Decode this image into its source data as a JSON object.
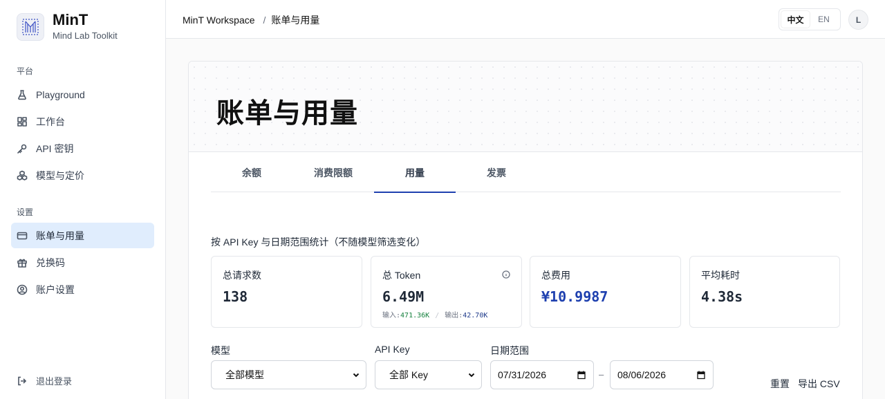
{
  "brand": {
    "name": "MinT",
    "subtitle": "Mind Lab Toolkit"
  },
  "sidebar": {
    "platform_label": "平台",
    "platform_items": [
      {
        "label": "Playground",
        "icon": "flask-icon"
      },
      {
        "label": "工作台",
        "icon": "dashboard-icon"
      },
      {
        "label": "API 密钥",
        "icon": "key-icon"
      },
      {
        "label": "模型与定价",
        "icon": "cubes-icon"
      }
    ],
    "settings_label": "设置",
    "settings_items": [
      {
        "label": "账单与用量",
        "icon": "credit-card-icon",
        "active": true
      },
      {
        "label": "兑换码",
        "icon": "gift-icon"
      },
      {
        "label": "账户设置",
        "icon": "user-circle-icon"
      }
    ],
    "logout_label": "退出登录"
  },
  "header": {
    "workspace": "MinT Workspace",
    "separator": "/",
    "current": "账单与用量",
    "lang_zh": "中文",
    "lang_en": "EN",
    "avatar_initial": "L"
  },
  "page": {
    "title": "账单与用量",
    "tabs": [
      {
        "label": "余额"
      },
      {
        "label": "消费限额"
      },
      {
        "label": "用量",
        "active": true
      },
      {
        "label": "发票"
      }
    ],
    "stat_note": "按 API Key 与日期范围统计（不随模型筛选变化）",
    "stats": {
      "requests": {
        "label": "总请求数",
        "value": "138"
      },
      "tokens": {
        "label": "总 Token",
        "value": "6.49M",
        "input_label": "输入:",
        "input_value": "471.36K",
        "sep": "/",
        "output_label": "输出:",
        "output_value": "42.70K"
      },
      "cost": {
        "label": "总费用",
        "value": "¥10.9987"
      },
      "latency": {
        "label": "平均耗时",
        "value": "4.38s"
      }
    },
    "filters": {
      "model_label": "模型",
      "model_value": "全部模型",
      "key_label": "API Key",
      "key_value": "全部 Key",
      "date_label": "日期范围",
      "date_from": "07/31/2026",
      "date_to": "08/06/2026",
      "date_dash": "–",
      "reset_label": "重置",
      "export_label": "导出 CSV"
    }
  }
}
